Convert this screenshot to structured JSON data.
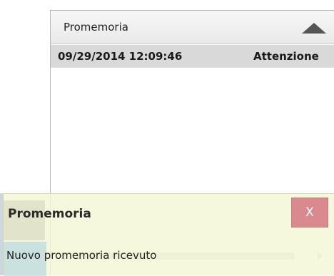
{
  "panel": {
    "title": "Promemoria",
    "rows": [
      {
        "date": "09/29/2014 12:09:46",
        "type": "Attenzione"
      }
    ]
  },
  "toast": {
    "title": "Promemoria",
    "close_label": "X",
    "message": "Nuovo promemoria ricevuto"
  },
  "icons": {
    "collapse": "triangle-up-icon",
    "scroll_left": "arrow-left-icon",
    "scroll_right": "arrow-right-icon"
  },
  "colors": {
    "header_bg": "#e9e9e9",
    "row_highlight": "#d9d9d9",
    "toast_bg": "#f4f6d6",
    "close_bg": "#d98a8f"
  }
}
